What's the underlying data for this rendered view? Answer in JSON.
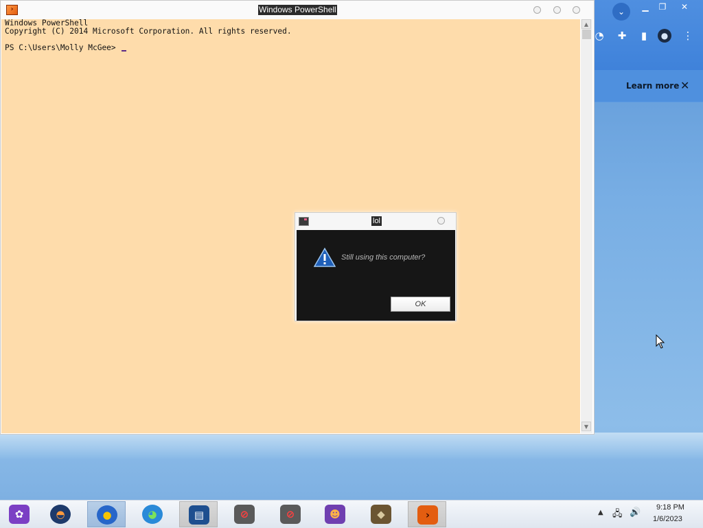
{
  "powershell": {
    "title": "Windows PowerShell",
    "lines": [
      "Windows PowerShell",
      "Copyright (C) 2014 Microsoft Corporation. All rights reserved.",
      "PS C:\\Users\\Molly McGee> "
    ]
  },
  "dialog": {
    "title": "lol",
    "message": "Still using this computer?",
    "ok_label": "OK",
    "icon": "warning-icon"
  },
  "browser": {
    "learn_more": "Learn more",
    "close_glyph": "✕",
    "icons": [
      "chevron-down-icon",
      "extensions-icon",
      "sidebar-icon",
      "profile-icon",
      "more-icon"
    ]
  },
  "taskbar": {
    "apps": [
      {
        "name": "app-flower",
        "color": "#e34b8c"
      },
      {
        "name": "app-sunset",
        "color": "#f07b28"
      },
      {
        "name": "app-browser-circle",
        "color": "#f2b100"
      },
      {
        "name": "app-firefox",
        "color": "#2a8ad8"
      },
      {
        "name": "app-files",
        "color": "#2c5fa8"
      },
      {
        "name": "app-installer-1",
        "color": "#c0392b"
      },
      {
        "name": "app-installer-2",
        "color": "#c0392b"
      },
      {
        "name": "app-people",
        "color": "#8e44ad"
      },
      {
        "name": "app-diamond",
        "color": "#8a6d3b"
      },
      {
        "name": "app-powershell",
        "color": "#e35d10"
      }
    ],
    "time": "9:18 PM",
    "date": "1/6/2023"
  }
}
